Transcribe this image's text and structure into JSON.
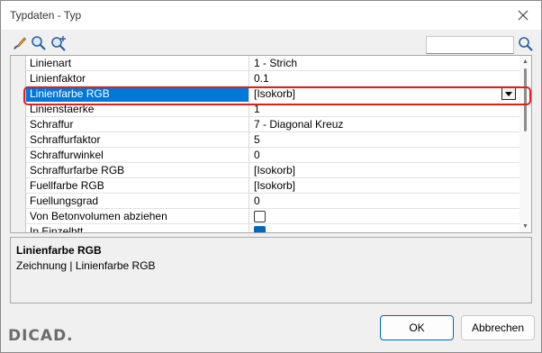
{
  "window": {
    "title": "Typdaten - Typ"
  },
  "toolbar": {
    "icons": [
      "brush-icon",
      "zoom-icon",
      "zoom-plus-icon"
    ],
    "search_value": ""
  },
  "properties": [
    {
      "name": "Linienart",
      "value": "1 - Strich",
      "type": "text"
    },
    {
      "name": "Linienfaktor",
      "value": "0.1",
      "type": "text"
    },
    {
      "name": "Linienfarbe RGB",
      "value": "[Isokorb]",
      "type": "dropdown",
      "selected": true
    },
    {
      "name": "Linienstaerke",
      "value": "1",
      "type": "text"
    },
    {
      "name": "Schraffur",
      "value": "7 - Diagonal Kreuz",
      "type": "text"
    },
    {
      "name": "Schraffurfaktor",
      "value": "5",
      "type": "text"
    },
    {
      "name": "Schraffurwinkel",
      "value": "0",
      "type": "text"
    },
    {
      "name": "Schraffurfarbe RGB",
      "value": "[Isokorb]",
      "type": "text"
    },
    {
      "name": "Fuellfarbe RGB",
      "value": "[Isokorb]",
      "type": "text"
    },
    {
      "name": "Fuellungsgrad",
      "value": "0",
      "type": "text"
    },
    {
      "name": "Von Betonvolumen abziehen",
      "value": "",
      "type": "checkbox",
      "checked": false
    },
    {
      "name": "In Einzelbtt...",
      "value": "",
      "type": "checkbox",
      "checked": true
    }
  ],
  "description": {
    "title": "Linienfarbe RGB",
    "text": "Zeichnung | Linienfarbe RGB"
  },
  "footer": {
    "logo": "DICAD.",
    "ok_label": "OK",
    "cancel_label": "Abbrechen"
  },
  "colors": {
    "selection": "#0078d7",
    "highlight_border": "#e02020",
    "primary_border": "#0067c0"
  }
}
